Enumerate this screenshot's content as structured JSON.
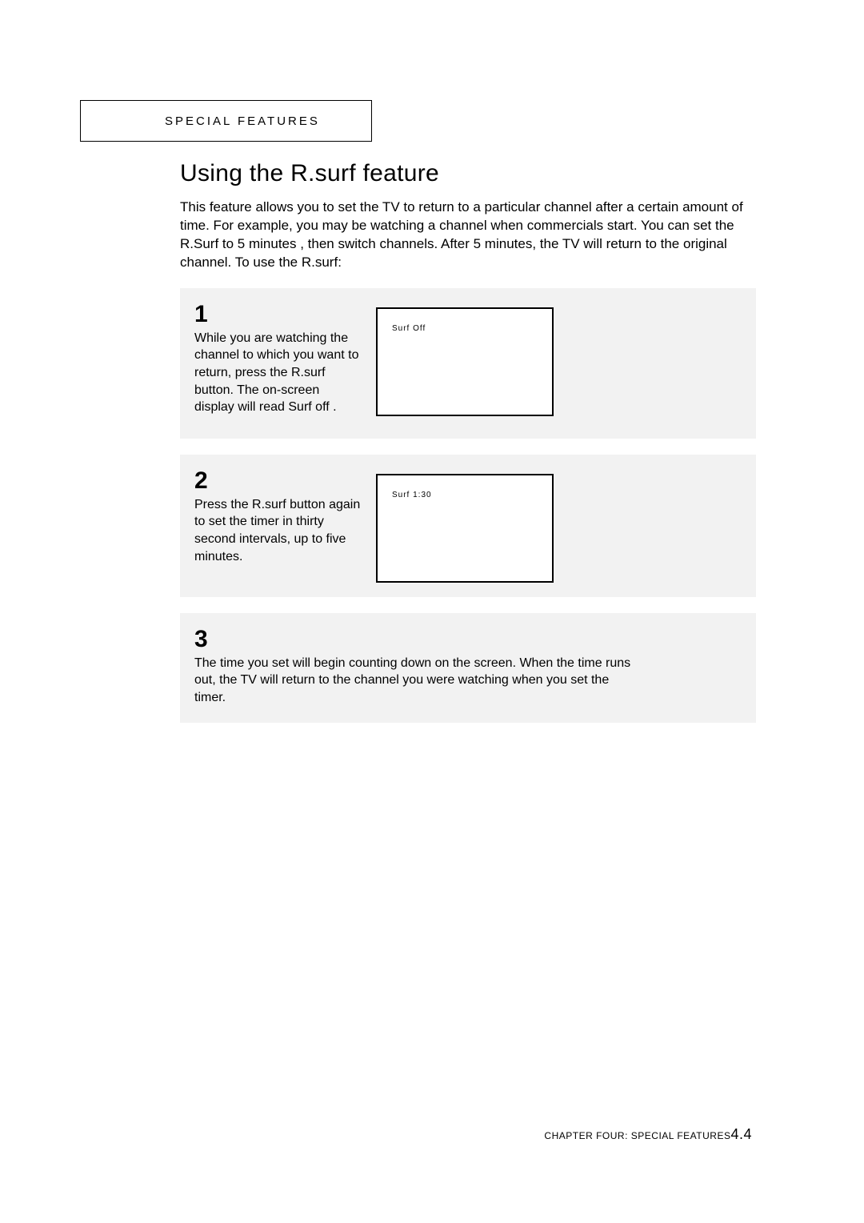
{
  "header": {
    "label": "SPECIAL FEATURES"
  },
  "title": "Using the R.surf feature",
  "intro": "This feature allows you to set the TV to return to a particular channel after a certain amount of time. For example, you may be watching a channel when commercials start. You can set the R.Surf to  5 minutes , then switch channels. After 5 minutes, the TV will return to the original channel. To use the R.surf:",
  "steps": [
    {
      "num": "1",
      "text_before": "While you are watching the channel to which you want to return, press the ",
      "button_label": "R.surf",
      "text_after": " button. The on-screen display will read  Surf off .",
      "tv": "Surf    Off"
    },
    {
      "num": "2",
      "text_before": "Press the ",
      "button_label": "R.surf",
      "text_after": " button again to set the timer in thirty second intervals, up to five minutes.",
      "tv": "Surf    1:30"
    },
    {
      "num": "3",
      "text": "The time you set will begin counting down on the screen. When the time runs out, the TV will return to the channel you were watching when you set the timer."
    }
  ],
  "footer": {
    "chapter_label": "CHAPTER FOUR: SPECIAL FEATURES",
    "page_num": "4.4"
  }
}
